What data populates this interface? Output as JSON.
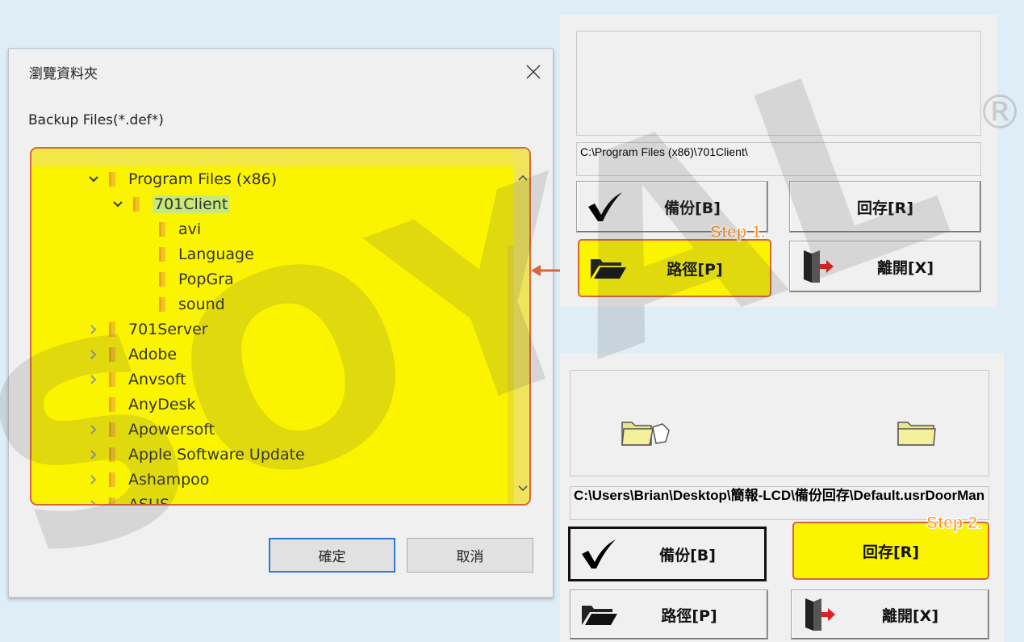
{
  "dialog": {
    "title": "瀏覽資料夾",
    "description": "Backup Files(*.def*)",
    "tree": [
      {
        "label": "Program Files (x86)",
        "expander": "expanded",
        "level": 1,
        "selected": false
      },
      {
        "label": "701Client",
        "expander": "expanded",
        "level": 2,
        "selected": true
      },
      {
        "label": "avi",
        "expander": "none",
        "level": 3,
        "selected": false
      },
      {
        "label": "Language",
        "expander": "none",
        "level": 3,
        "selected": false
      },
      {
        "label": "PopGra",
        "expander": "none",
        "level": 3,
        "selected": false
      },
      {
        "label": "sound",
        "expander": "none",
        "level": 3,
        "selected": false
      },
      {
        "label": "701Server",
        "expander": "collapsed",
        "level": 1,
        "selected": false
      },
      {
        "label": "Adobe",
        "expander": "collapsed",
        "level": 1,
        "selected": false
      },
      {
        "label": "Anvsoft",
        "expander": "collapsed",
        "level": 1,
        "selected": false
      },
      {
        "label": "AnyDesk",
        "expander": "none",
        "level": 1,
        "selected": false
      },
      {
        "label": "Apowersoft",
        "expander": "collapsed",
        "level": 1,
        "selected": false
      },
      {
        "label": "Apple Software Update",
        "expander": "collapsed",
        "level": 1,
        "selected": false
      },
      {
        "label": "Ashampoo",
        "expander": "collapsed",
        "level": 1,
        "selected": false
      },
      {
        "label": "ASUS",
        "expander": "collapsed",
        "level": 1,
        "selected": false
      }
    ],
    "ok_label": "確定",
    "cancel_label": "取消",
    "highlight_color": "#fbf400",
    "highlight_border_color": "#d9653a"
  },
  "panel_top": {
    "path": "C:\\Program Files (x86)\\701Client\\",
    "backup_label": "備份[B]",
    "restore_label": "回存[R]",
    "path_label": "路徑[P]",
    "exit_label": "離開[X]",
    "step_label": "Step 1."
  },
  "panel_bottom": {
    "path": "C:\\Users\\Brian\\Desktop\\簡報-LCD\\備份回存\\Default.usrDoorMan",
    "backup_label": "備份[B]",
    "restore_label": "回存[R]",
    "path_label": "路徑[P]",
    "exit_label": "離開[X]",
    "step_label": "Step 2."
  },
  "watermark": {
    "text": "SOYAL",
    "mark": "®"
  }
}
